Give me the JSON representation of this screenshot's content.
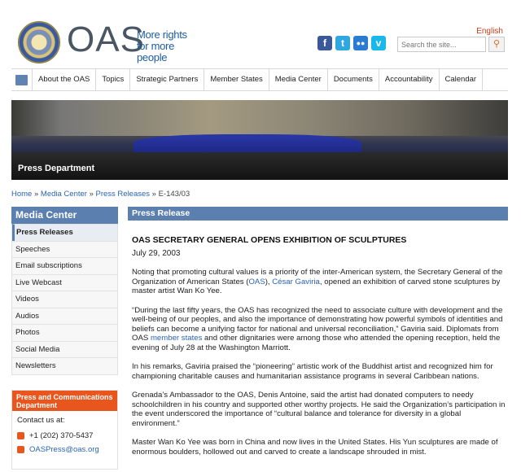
{
  "header": {
    "brand": "OAS",
    "tagline": "More rights for more people",
    "language_link": "English",
    "search_placeholder": "Search the site...",
    "social": [
      "facebook-icon",
      "twitter-icon",
      "flickr-icon",
      "vimeo-icon"
    ]
  },
  "nav": {
    "items": [
      "About the OAS",
      "Topics",
      "Strategic Partners",
      "Member States",
      "Media Center",
      "Documents",
      "Accountability",
      "Calendar"
    ]
  },
  "banner": {
    "caption": "Press Department"
  },
  "breadcrumb": {
    "home": "Home",
    "sep": " » ",
    "media_center": "Media Center",
    "press_releases": "Press Releases",
    "current": "E-143/03"
  },
  "sidebar": {
    "title": "Media Center",
    "items": [
      "Press Releases",
      "Speeches",
      "Email subscriptions",
      "Live Webcast",
      "Videos",
      "Audios",
      "Photos",
      "Social Media",
      "Newsletters"
    ]
  },
  "contact": {
    "title": "Press and Communications Department",
    "intro": "Contact us at:",
    "phone": "+1 (202) 370-5437",
    "email": "OASPress@oas.org"
  },
  "main": {
    "header": "Press Release",
    "title": "OAS SECRETARY GENERAL OPENS EXHIBITION OF SCULPTURES",
    "date": "July 29, 2003",
    "p1_a": "Noting that promoting cultural values is a priority of the inter-American system, the Secretary General of the Organization of American States (",
    "p1_link1": "OAS",
    "p1_b": "), ",
    "p1_link2": "César Gaviria",
    "p1_c": ", opened an exhibition of carved stone sculptures by master artist Wan Ko Yee.",
    "p2_a": "“During the last fifty years, the OAS has recognized the need to associate culture with development and the well-being of our peoples, and also the importance of demonstrating how powerful symbols of identities and beliefs can become a unifying factor for national and universal reconciliation,” Gaviria said. Diplomats from OAS ",
    "p2_link": "member states",
    "p2_b": " and other dignitaries were among those who attended the opening reception, held the evening of July 28 at the Washington Marriott.",
    "p3": "In his remarks, Gaviria praised the “pioneering” artistic work of the Buddhist artist and recognized him for championing charitable causes and humanitarian assistance programs in several Caribbean nations.",
    "p4": "Grenada’s Ambassador to the OAS, Denis Antoine, said the artist had donated computers to needy schoolchildren in his country and supported other worthy projects. He said the Organization’s participation in the event underscored the importance of “cultural balance and tolerance for diversity in a global environment.”",
    "p5": "Master Wan Ko Yee was born in China and now lives in the United States. His Yun sculptures are made of enormous boulders, hollowed out and carved to create a landscape shrouded in mist."
  }
}
